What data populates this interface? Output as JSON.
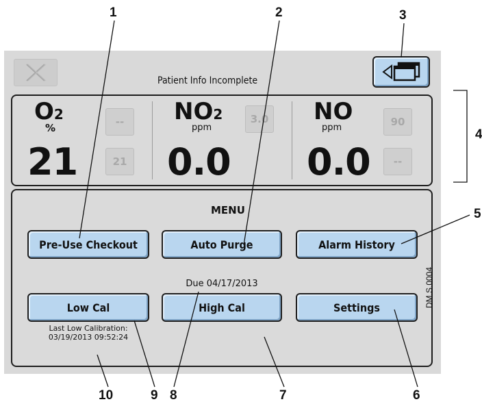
{
  "header": {
    "status_text": "Patient Info Incomplete",
    "close_icon": "close-x-icon",
    "window_icon": "windows-back-icon"
  },
  "gases": [
    {
      "name": "O",
      "sub": "2",
      "unit": "%",
      "value": "21",
      "upper_box": "--",
      "lower_box": "21"
    },
    {
      "name": "NO",
      "sub": "2",
      "unit": "ppm",
      "value": "0.0",
      "upper_box": "3.0",
      "lower_box": ""
    },
    {
      "name": "NO",
      "sub": "",
      "unit": "ppm",
      "value": "0.0",
      "upper_box": "90",
      "lower_box": "--"
    }
  ],
  "menu": {
    "title": "MENU",
    "pre_use_checkout": "Pre-Use Checkout",
    "auto_purge": "Auto Purge",
    "alarm_history": "Alarm History",
    "low_cal": "Low Cal",
    "high_cal": "High Cal",
    "settings": "Settings",
    "due_text": "Due 04/17/2013",
    "last_low_cal_label": "Last Low Calibration:",
    "last_low_cal_value": "03/19/2013 09:52:24"
  },
  "callouts": [
    "1",
    "2",
    "3",
    "4",
    "5",
    "6",
    "7",
    "8",
    "9",
    "10"
  ],
  "watermark": "DM.S.0004",
  "colors": {
    "button": "#b9d6ef",
    "panel": "#dadada",
    "device": "#d9d9d9",
    "border": "#1c1c1c"
  }
}
